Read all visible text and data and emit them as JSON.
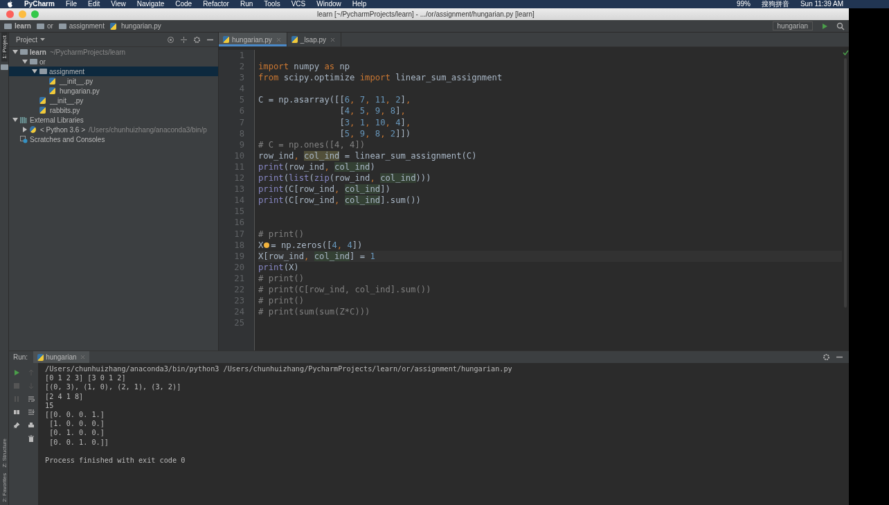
{
  "menu_bar": {
    "app": "PyCharm",
    "items": [
      "File",
      "Edit",
      "View",
      "Navigate",
      "Code",
      "Refactor",
      "Run",
      "Tools",
      "VCS",
      "Window",
      "Help"
    ],
    "battery": "99%",
    "input_method": "搜狗拼音",
    "clock": "Sun 11:39 AM"
  },
  "window": {
    "title": "learn [~/PycharmProjects/learn] - .../or/assignment/hungarian.py [learn]"
  },
  "breadcrumbs": [
    {
      "label": "learn",
      "kind": "folder"
    },
    {
      "label": "or",
      "kind": "folder"
    },
    {
      "label": "assignment",
      "kind": "folder"
    },
    {
      "label": "hungarian.py",
      "kind": "python"
    }
  ],
  "run_config": "hungarian",
  "side_stripe": {
    "top": "1: Project",
    "structure": "Z: Structure",
    "favorites": "2: Favorites"
  },
  "project_panel": {
    "title": "Project",
    "tree": [
      {
        "label": "learn",
        "hint": "~/PycharmProjects/learn",
        "kind": "folder",
        "expanded": true,
        "selected": false,
        "children": [
          {
            "label": "or",
            "kind": "folder",
            "expanded": true,
            "selected": false,
            "children": [
              {
                "label": "assignment",
                "kind": "folder",
                "expanded": true,
                "selected": true,
                "children": [
                  {
                    "label": "__init__.py",
                    "kind": "python",
                    "selected": false
                  },
                  {
                    "label": "hungarian.py",
                    "kind": "python",
                    "selected": false
                  }
                ]
              },
              {
                "label": "__init__.py",
                "kind": "python",
                "selected": false
              },
              {
                "label": "rabbits.py",
                "kind": "python",
                "selected": false
              }
            ]
          }
        ]
      },
      {
        "label": "External Libraries",
        "kind": "library",
        "expanded": true,
        "selected": false,
        "children": [
          {
            "label": "< Python 3.6 >",
            "hint": "/Users/chunhuizhang/anaconda3/bin/p",
            "kind": "sdk",
            "expanded": false,
            "selected": false
          }
        ]
      },
      {
        "label": "Scratches and Consoles",
        "kind": "scratch",
        "selected": false
      }
    ]
  },
  "editor_tabs": [
    {
      "label": "hungarian.py",
      "selected": true
    },
    {
      "label": "_lsap.py",
      "selected": false
    }
  ],
  "code": [
    {
      "number": "1"
    },
    {
      "number": "2",
      "tokens": [
        {
          "kind": "kw",
          "text": "import"
        },
        {
          "kind": "tx",
          "text": " numpy "
        },
        {
          "kind": "kw",
          "text": "as"
        },
        {
          "kind": "tx",
          "text": " np"
        }
      ]
    },
    {
      "number": "3",
      "tokens": [
        {
          "kind": "kw",
          "text": "from"
        },
        {
          "kind": "tx",
          "text": " scipy.optimize "
        },
        {
          "kind": "kw",
          "text": "import"
        },
        {
          "kind": "tx",
          "text": " linear_sum_assignment"
        }
      ]
    },
    {
      "number": "4"
    },
    {
      "number": "5",
      "tokens": [
        {
          "kind": "tx",
          "text": "C = np.asarray([["
        },
        {
          "kind": "num",
          "text": "6"
        },
        {
          "kind": "kw",
          "text": ", "
        },
        {
          "kind": "num",
          "text": "7"
        },
        {
          "kind": "kw",
          "text": ", "
        },
        {
          "kind": "num",
          "text": "11"
        },
        {
          "kind": "kw",
          "text": ", "
        },
        {
          "kind": "num",
          "text": "2"
        },
        {
          "kind": "tx",
          "text": "]"
        },
        {
          "kind": "kw",
          "text": ","
        }
      ]
    },
    {
      "number": "6",
      "tokens": [
        {
          "kind": "tx",
          "text": "                ["
        },
        {
          "kind": "num",
          "text": "4"
        },
        {
          "kind": "kw",
          "text": ", "
        },
        {
          "kind": "num",
          "text": "5"
        },
        {
          "kind": "kw",
          "text": ", "
        },
        {
          "kind": "num",
          "text": "9"
        },
        {
          "kind": "kw",
          "text": ", "
        },
        {
          "kind": "num",
          "text": "8"
        },
        {
          "kind": "tx",
          "text": "]"
        },
        {
          "kind": "kw",
          "text": ","
        }
      ]
    },
    {
      "number": "7",
      "tokens": [
        {
          "kind": "tx",
          "text": "                ["
        },
        {
          "kind": "num",
          "text": "3"
        },
        {
          "kind": "kw",
          "text": ", "
        },
        {
          "kind": "num",
          "text": "1"
        },
        {
          "kind": "kw",
          "text": ", "
        },
        {
          "kind": "num",
          "text": "10"
        },
        {
          "kind": "kw",
          "text": ", "
        },
        {
          "kind": "num",
          "text": "4"
        },
        {
          "kind": "tx",
          "text": "]"
        },
        {
          "kind": "kw",
          "text": ","
        }
      ]
    },
    {
      "number": "8",
      "tokens": [
        {
          "kind": "tx",
          "text": "                ["
        },
        {
          "kind": "num",
          "text": "5"
        },
        {
          "kind": "kw",
          "text": ", "
        },
        {
          "kind": "num",
          "text": "9"
        },
        {
          "kind": "kw",
          "text": ", "
        },
        {
          "kind": "num",
          "text": "8"
        },
        {
          "kind": "kw",
          "text": ", "
        },
        {
          "kind": "num",
          "text": "2"
        },
        {
          "kind": "tx",
          "text": "]])"
        }
      ]
    },
    {
      "number": "9",
      "tokens": [
        {
          "kind": "cm",
          "text": "# C = np.ones([4, 4])"
        }
      ]
    },
    {
      "number": "10",
      "tokens": [
        {
          "kind": "tx",
          "text": "row_ind"
        },
        {
          "kind": "kw",
          "text": ", "
        },
        {
          "kind": "warn",
          "text": "col_ind"
        },
        {
          "kind": "tx",
          "text": " = linear_sum_assignment(C)"
        }
      ]
    },
    {
      "number": "11",
      "tokens": [
        {
          "kind": "fn",
          "text": "print"
        },
        {
          "kind": "tx",
          "text": "(row_ind"
        },
        {
          "kind": "kw",
          "text": ", "
        },
        {
          "kind": "hl",
          "text": "col_ind"
        },
        {
          "kind": "tx",
          "text": ")"
        }
      ]
    },
    {
      "number": "12",
      "tokens": [
        {
          "kind": "fn",
          "text": "print"
        },
        {
          "kind": "tx",
          "text": "("
        },
        {
          "kind": "fn",
          "text": "list"
        },
        {
          "kind": "tx",
          "text": "("
        },
        {
          "kind": "fn",
          "text": "zip"
        },
        {
          "kind": "tx",
          "text": "(row_ind"
        },
        {
          "kind": "kw",
          "text": ", "
        },
        {
          "kind": "hl",
          "text": "col_ind"
        },
        {
          "kind": "tx",
          "text": ")))"
        }
      ]
    },
    {
      "number": "13",
      "tokens": [
        {
          "kind": "fn",
          "text": "print"
        },
        {
          "kind": "tx",
          "text": "(C[row_ind"
        },
        {
          "kind": "kw",
          "text": ", "
        },
        {
          "kind": "hl",
          "text": "col_ind"
        },
        {
          "kind": "tx",
          "text": "])"
        }
      ]
    },
    {
      "number": "14",
      "tokens": [
        {
          "kind": "fn",
          "text": "print"
        },
        {
          "kind": "tx",
          "text": "(C[row_ind"
        },
        {
          "kind": "kw",
          "text": ", "
        },
        {
          "kind": "hl",
          "text": "col_ind"
        },
        {
          "kind": "tx",
          "text": "].sum())"
        }
      ]
    },
    {
      "number": "15"
    },
    {
      "number": "16"
    },
    {
      "number": "17",
      "tokens": [
        {
          "kind": "cm",
          "text": "# print()"
        }
      ]
    },
    {
      "number": "18",
      "tokens": [
        {
          "kind": "tx",
          "text": "X"
        },
        {
          "kind": "bulb"
        },
        {
          "kind": "tx",
          "text": "= np.zeros(["
        },
        {
          "kind": "num",
          "text": "4"
        },
        {
          "kind": "kw",
          "text": ", "
        },
        {
          "kind": "num",
          "text": "4"
        },
        {
          "kind": "tx",
          "text": "])"
        }
      ]
    },
    {
      "number": "19",
      "tokens": [
        {
          "kind": "tx",
          "text": "X[row_ind"
        },
        {
          "kind": "kw",
          "text": ", "
        },
        {
          "kind": "hl",
          "text": "col_ind"
        },
        {
          "kind": "tx",
          "text": "] = "
        },
        {
          "kind": "num",
          "text": "1"
        }
      ]
    },
    {
      "number": "20",
      "tokens": [
        {
          "kind": "fn",
          "text": "print"
        },
        {
          "kind": "tx",
          "text": "(X)"
        }
      ]
    },
    {
      "number": "21",
      "tokens": [
        {
          "kind": "cm",
          "text": "# print()"
        }
      ]
    },
    {
      "number": "22",
      "tokens": [
        {
          "kind": "cm",
          "text": "# print(C[row_ind, col_ind].sum())"
        }
      ]
    },
    {
      "number": "23",
      "tokens": [
        {
          "kind": "cm",
          "text": "# print()"
        }
      ]
    },
    {
      "number": "24",
      "tokens": [
        {
          "kind": "cm",
          "text": "# print(sum(sum(Z*C)))"
        }
      ]
    },
    {
      "number": "25"
    }
  ],
  "run_panel": {
    "label": "Run:",
    "tab": "hungarian",
    "output_blocks": [
      [
        "/Users/chunhuizhang/anaconda3/bin/python3 /Users/chunhuizhang/PycharmProjects/learn/or/assignment/hungarian.py",
        "[0 1 2 3] [3 0 1 2]",
        "[(0, 3), (1, 0), (2, 1), (3, 2)]",
        "[2 4 1 8]",
        "15",
        "[[0. 0. 0. 1.]",
        " [1. 0. 0. 0.]",
        " [0. 1. 0. 0.]",
        " [0. 0. 1. 0.]]"
      ],
      [
        "Process finished with exit code 0"
      ]
    ]
  }
}
